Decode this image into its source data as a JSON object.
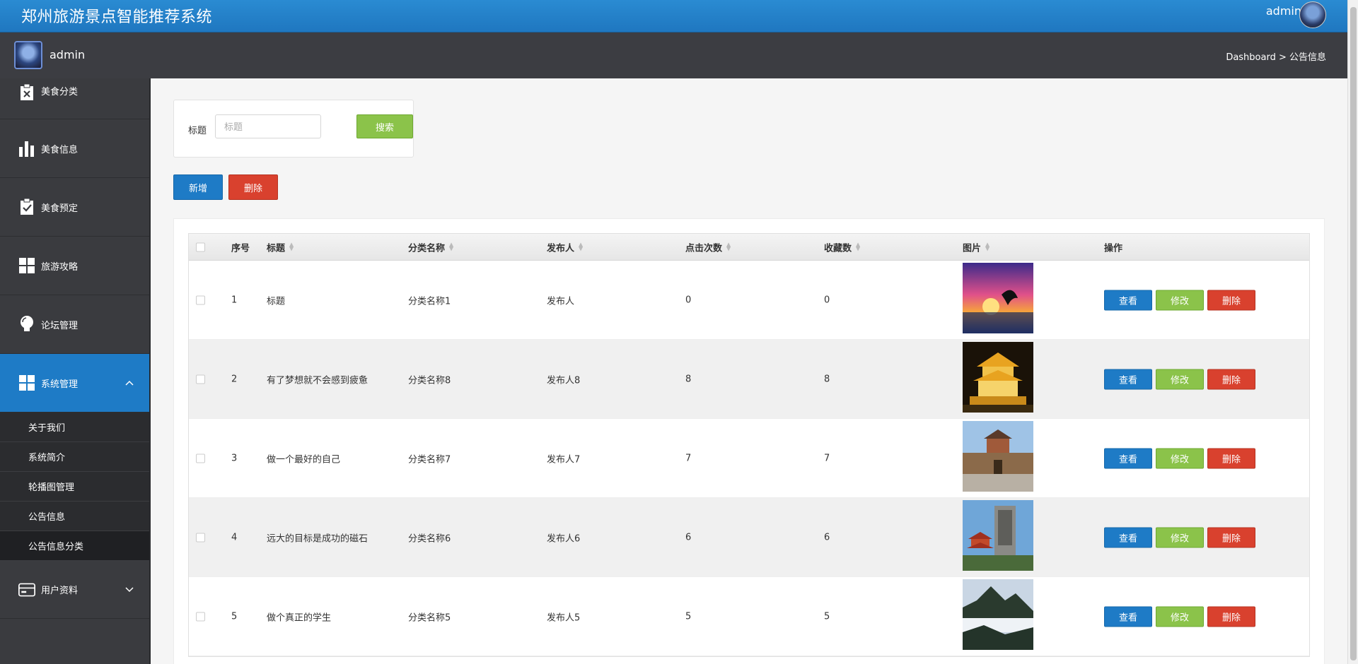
{
  "header": {
    "title": "郑州旅游景点智能推荐系统",
    "user": "admin"
  },
  "subbar": {
    "user": "admin",
    "breadcrumb": "Dashboard > 公告信息"
  },
  "sidebar": {
    "items": [
      {
        "label": "美食分类",
        "icon": "clipboard-x-icon"
      },
      {
        "label": "美食信息",
        "icon": "bar-chart-icon"
      },
      {
        "label": "美食预定",
        "icon": "clipboard-check-icon"
      },
      {
        "label": "旅游攻略",
        "icon": "grid-icon"
      },
      {
        "label": "论坛管理",
        "icon": "lightbulb-icon"
      },
      {
        "label": "系统管理",
        "icon": "grid-icon"
      },
      {
        "label": "用户资料",
        "icon": "card-icon"
      }
    ],
    "submenu": [
      "关于我们",
      "系统简介",
      "轮播图管理",
      "公告信息",
      "公告信息分类"
    ]
  },
  "search": {
    "label": "标题",
    "placeholder": "标题",
    "button": "搜索"
  },
  "toolbar": {
    "add": "新增",
    "delete": "删除"
  },
  "table": {
    "headers": [
      "序号",
      "标题",
      "分类名称",
      "发布人",
      "点击次数",
      "收藏数",
      "图片",
      "操作"
    ],
    "actions": {
      "view": "查看",
      "edit": "修改",
      "delete": "删除"
    },
    "rows": [
      {
        "no": "1",
        "title": "标题",
        "category": "分类名称1",
        "publisher": "发布人",
        "clicks": "0",
        "favorites": "0"
      },
      {
        "no": "2",
        "title": "有了梦想就不会感到疲惫",
        "category": "分类名称8",
        "publisher": "发布人8",
        "clicks": "8",
        "favorites": "8"
      },
      {
        "no": "3",
        "title": "做一个最好的自己",
        "category": "分类名称7",
        "publisher": "发布人7",
        "clicks": "7",
        "favorites": "7"
      },
      {
        "no": "4",
        "title": "远大的目标是成功的磁石",
        "category": "分类名称6",
        "publisher": "发布人6",
        "clicks": "6",
        "favorites": "6"
      },
      {
        "no": "5",
        "title": "做个真正的学生",
        "category": "分类名称5",
        "publisher": "发布人5",
        "clicks": "5",
        "favorites": "5"
      }
    ]
  },
  "colors": {
    "primary": "#1e7bc6",
    "success": "#8bc34a",
    "danger": "#d9412e",
    "sidebar": "#3a3b3f"
  }
}
